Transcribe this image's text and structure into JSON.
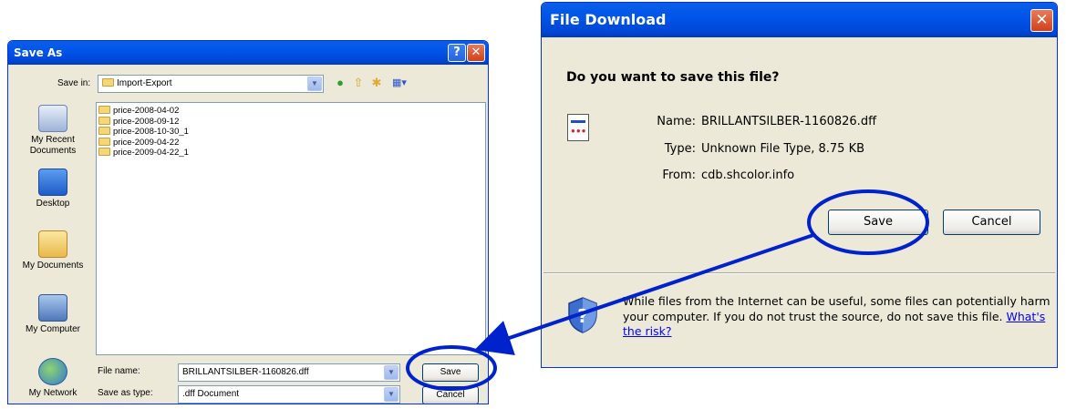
{
  "save_as": {
    "title": "Save As",
    "help_glyph": "?",
    "close_glyph": "✕",
    "save_in_label": "Save in:",
    "save_in_value": "Import-Export",
    "places": [
      {
        "label": "My Recent Documents"
      },
      {
        "label": "Desktop"
      },
      {
        "label": "My Documents"
      },
      {
        "label": "My Computer"
      },
      {
        "label": "My Network"
      }
    ],
    "files": [
      "price-2008-04-02",
      "price-2008-09-12",
      "price-2008-10-30_1",
      "price-2009-04-22",
      "price-2009-04-22_1"
    ],
    "file_name_label": "File name:",
    "file_name_value": "BRILLANTSILBER-1160826.dff",
    "save_as_type_label": "Save as type:",
    "save_as_type_value": ".dff Document",
    "save_button": "Save",
    "cancel_button": "Cancel",
    "icons": [
      "back-icon",
      "up-folder-icon",
      "new-folder-icon",
      "views-menu-icon"
    ]
  },
  "file_download": {
    "title": "File Download",
    "close_glyph": "✕",
    "question": "Do you want to save this file?",
    "name_label": "Name:",
    "name_value": "BRILLANTSILBER-1160826.dff",
    "type_label": "Type:",
    "type_value": "Unknown File Type, 8.75 KB",
    "from_label": "From:",
    "from_value": "cdb.shcolor.info",
    "save_button": "Save",
    "cancel_button": "Cancel",
    "warning_text": "While files from the Internet can be useful, some files can potentially harm your computer. If you do not trust the source, do not save this file.",
    "risk_link": "What's the risk?"
  },
  "colors": {
    "titlebar": "#0055EA",
    "dialog_face": "#ECE9D8",
    "highlight_ring": "#0022CC"
  }
}
